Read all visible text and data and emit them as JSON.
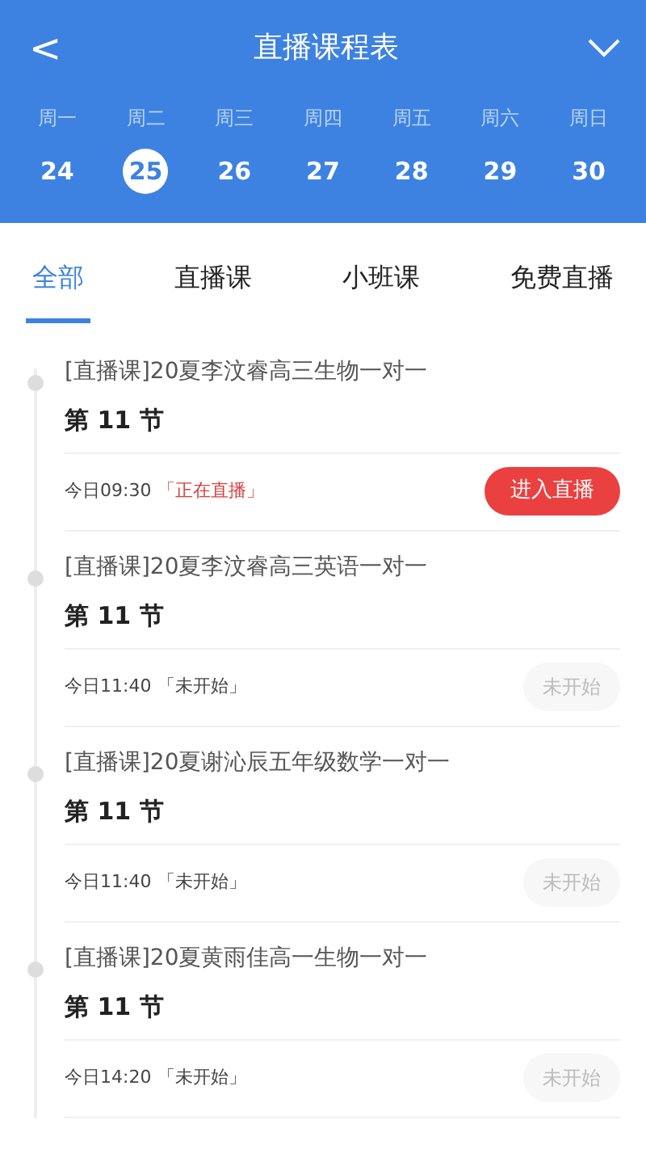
{
  "header": {
    "back": "<",
    "title": "直播课程表"
  },
  "week": [
    {
      "day": "周一",
      "date": "24",
      "selected": false
    },
    {
      "day": "周二",
      "date": "25",
      "selected": true
    },
    {
      "day": "周三",
      "date": "26",
      "selected": false
    },
    {
      "day": "周四",
      "date": "27",
      "selected": false
    },
    {
      "day": "周五",
      "date": "28",
      "selected": false
    },
    {
      "day": "周六",
      "date": "29",
      "selected": false
    },
    {
      "day": "周日",
      "date": "30",
      "selected": false
    }
  ],
  "tabs": [
    {
      "label": "全部",
      "selected": true
    },
    {
      "label": "直播课",
      "selected": false
    },
    {
      "label": "小班课",
      "selected": false
    },
    {
      "label": "免费直播",
      "selected": false
    }
  ],
  "lessons": [
    {
      "title": "[直播课]20夏李汶睿高三生物一对一",
      "lesson": "第 11 节",
      "time": "今日09:30",
      "status": "「正在直播」",
      "kind": "live",
      "button": "进入直播"
    },
    {
      "title": "[直播课]20夏李汶睿高三英语一对一",
      "lesson": "第 11 节",
      "time": "今日11:40",
      "status": "「未开始」",
      "kind": "upcoming",
      "button": "未开始"
    },
    {
      "title": "[直播课]20夏谢沁辰五年级数学一对一",
      "lesson": "第 11 节",
      "time": "今日11:40",
      "status": "「未开始」",
      "kind": "upcoming",
      "button": "未开始"
    },
    {
      "title": "[直播课]20夏黄雨佳高一生物一对一",
      "lesson": "第 11 节",
      "time": "今日14:20",
      "status": "「未开始」",
      "kind": "upcoming",
      "button": "未开始"
    }
  ]
}
